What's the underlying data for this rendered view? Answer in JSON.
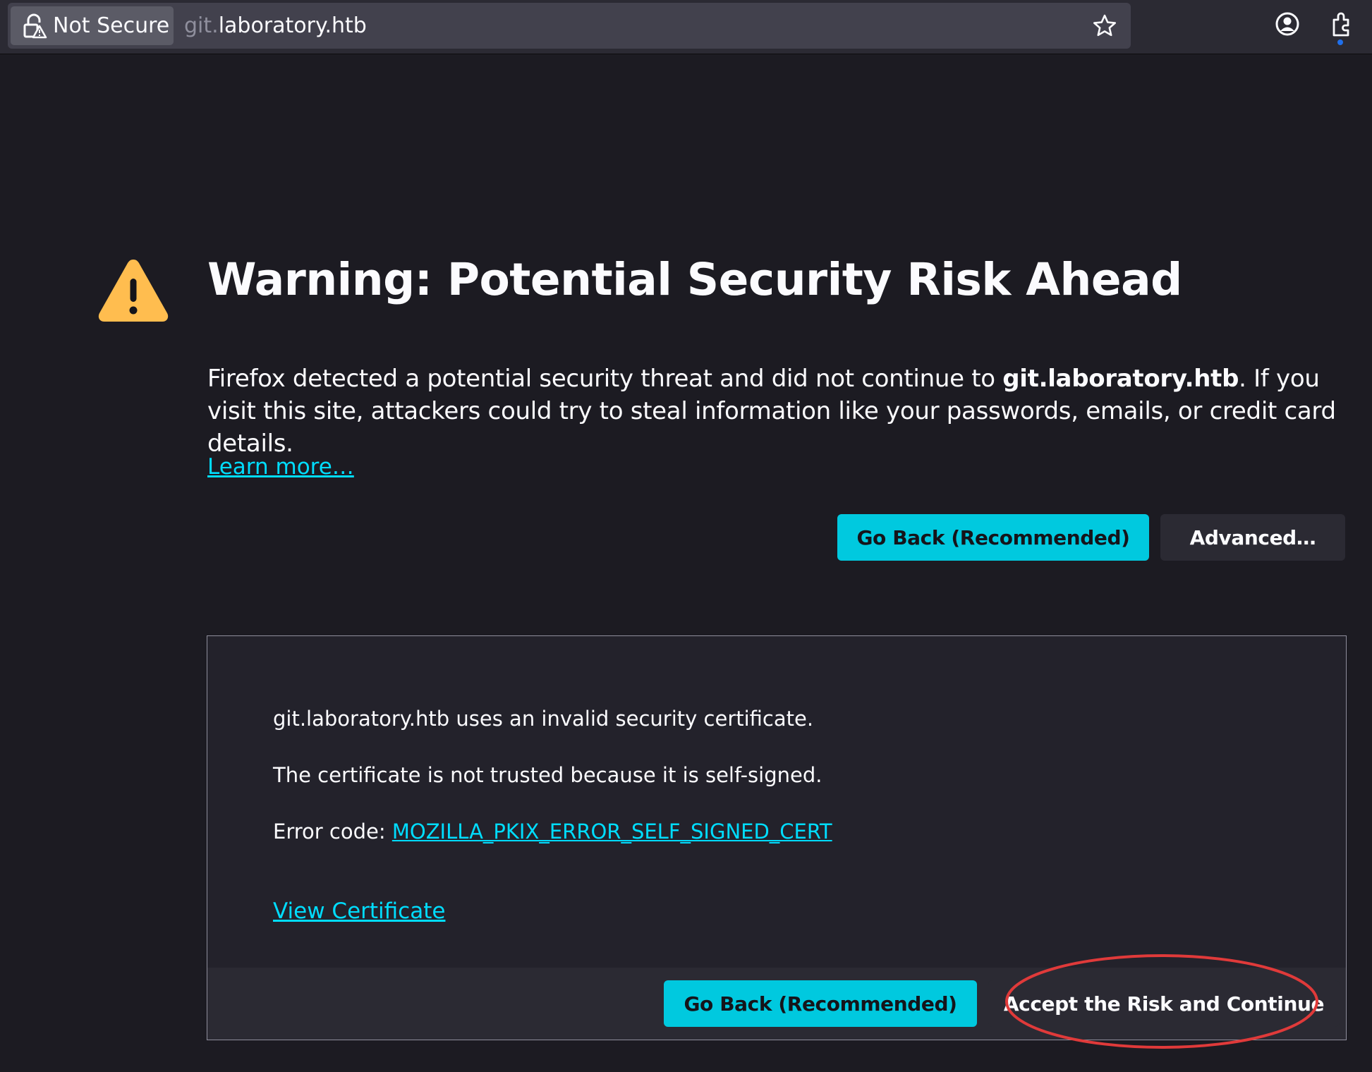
{
  "browser": {
    "identity_label": "Not Secure",
    "url_prefix": "git.",
    "url_host": "laboratory.htb",
    "icons": {
      "site_identity": "lock-warning-icon",
      "bookmark": "star-icon",
      "account": "account-icon",
      "extensions": "extensions-icon"
    }
  },
  "page": {
    "warning_icon": "warning-triangle-icon",
    "title": "Warning: Potential Security Risk Ahead",
    "intro_before": "Firefox detected a potential security threat and did not continue to ",
    "intro_host": "git.laboratory.htb",
    "intro_after": ". If you visit this site, attackers could try to steal information like your passwords, emails, or credit card details.",
    "learn_more": "Learn more…",
    "go_back_label": "Go Back (Recommended)",
    "advanced_label": "Advanced…"
  },
  "advanced": {
    "line_invalid_cert": "git.laboratory.htb uses an invalid security certificate.",
    "line_reason": "The certificate is not trusted because it is self-signed.",
    "error_code_label": "Error code: ",
    "error_code": "MOZILLA_PKIX_ERROR_SELF_SIGNED_CERT",
    "view_certificate": "View Certificate",
    "go_back_label": "Go Back (Recommended)",
    "accept_label": "Accept the Risk and Continue"
  },
  "colors": {
    "page_background": "#1c1b22",
    "accent_link": "#00ddff",
    "primary_button": "#00c9df",
    "warning_icon": "#ffbd4f",
    "annotation_ellipse": "#e03a3a"
  }
}
